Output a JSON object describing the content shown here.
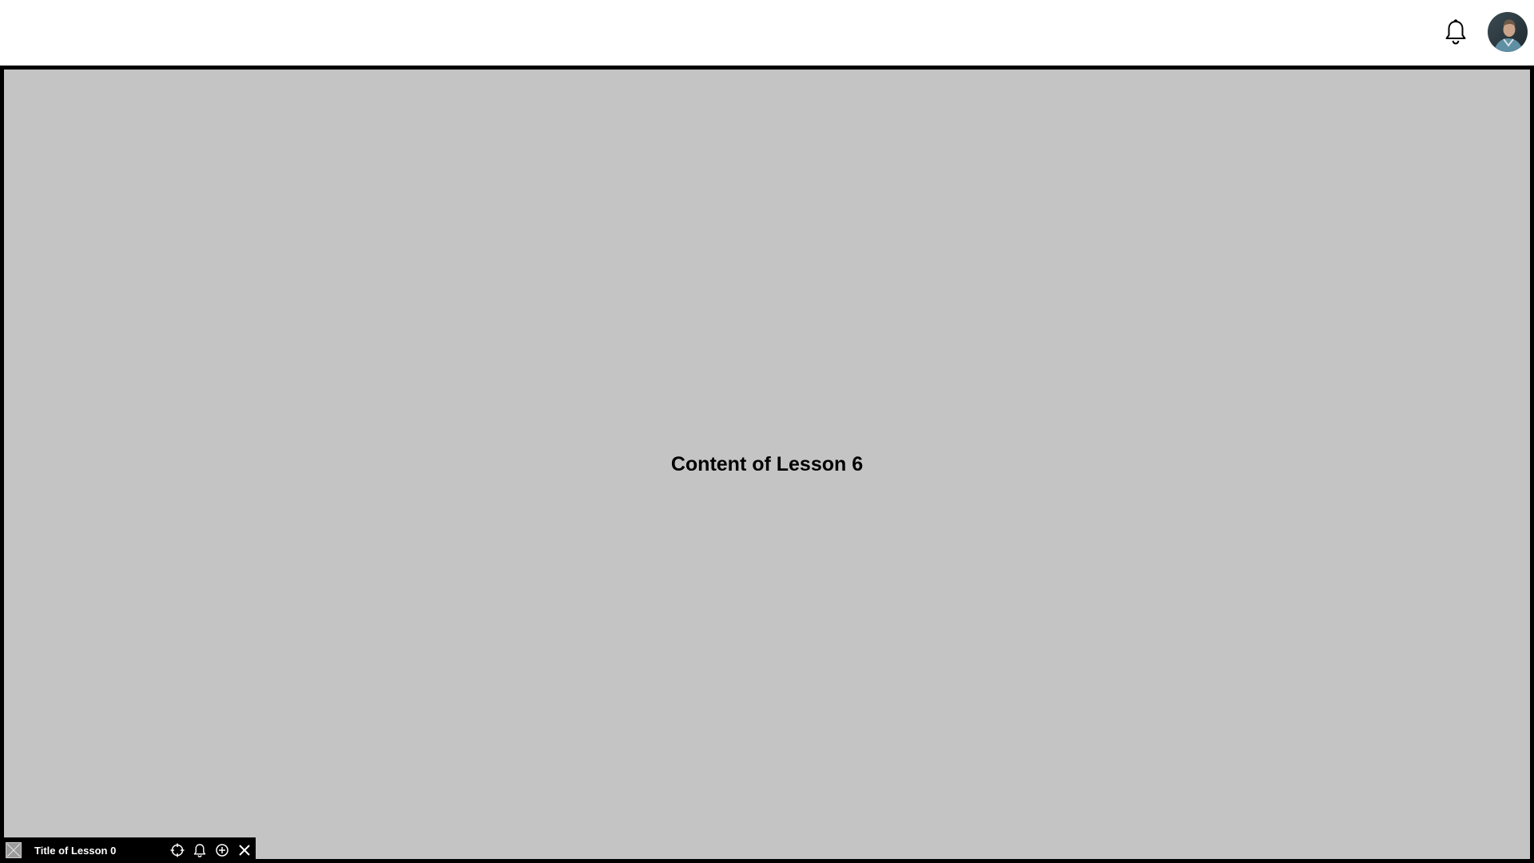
{
  "header": {
    "notifications_icon": "bell-icon",
    "avatar_icon": "user-avatar"
  },
  "main": {
    "content_text": "Content of Lesson 6",
    "background_color": "#c4c4c4"
  },
  "mini_player": {
    "title": "Title of Lesson 0",
    "icons": [
      "crosshair-icon",
      "bell-icon",
      "plus-circle-icon",
      "close-icon"
    ]
  }
}
